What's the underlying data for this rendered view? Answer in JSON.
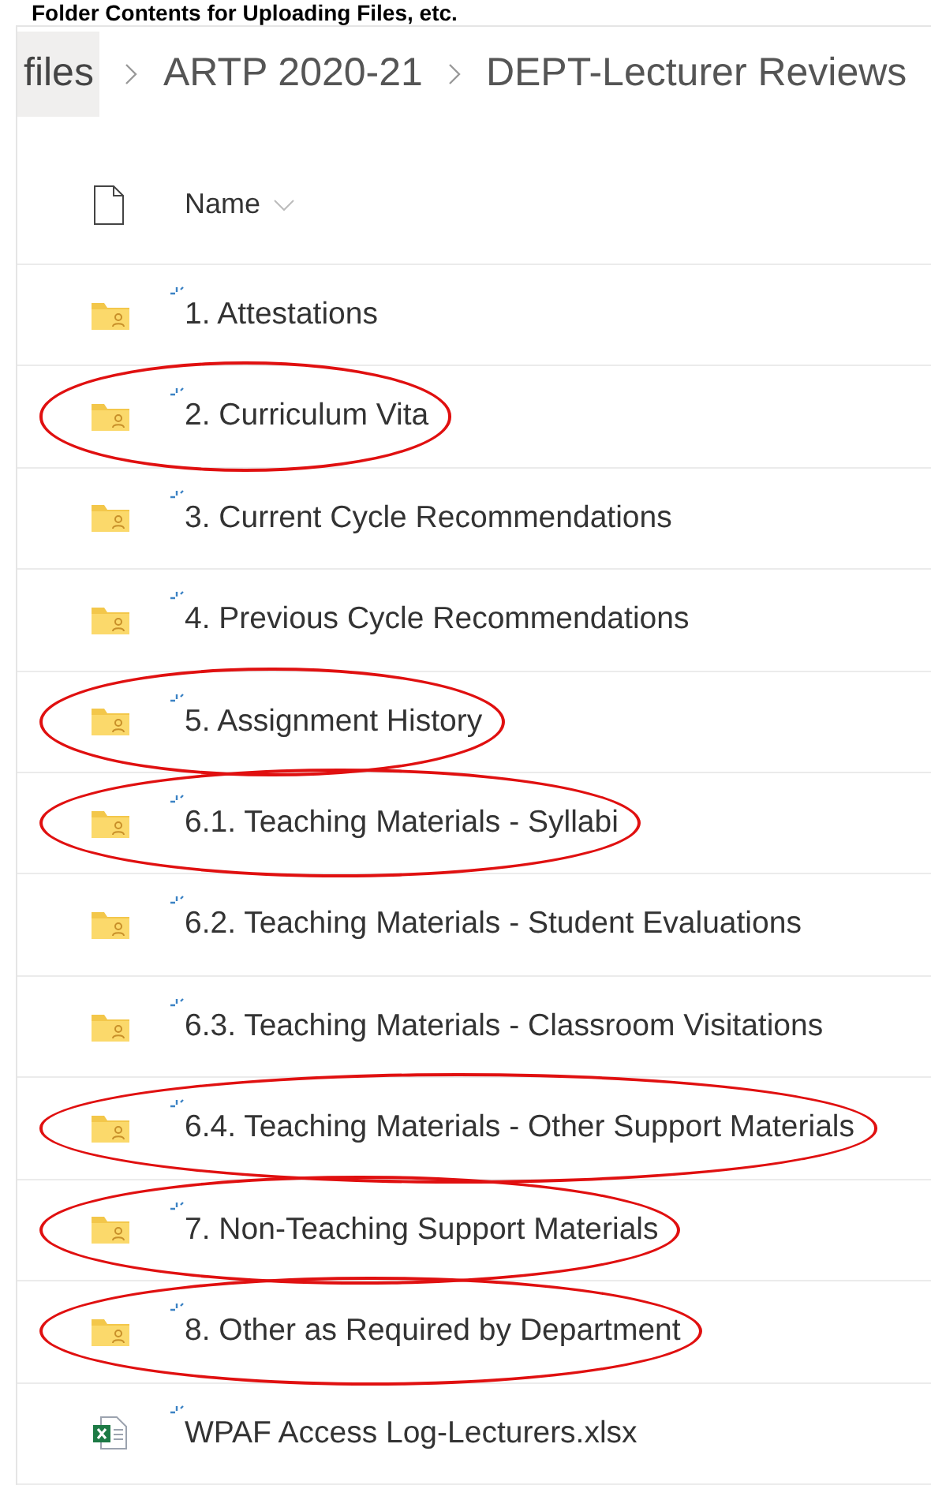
{
  "heading": "Folder Contents for Uploading Files, etc.",
  "breadcrumb": [
    {
      "label": "files",
      "selected": true
    },
    {
      "label": "ARTP 2020-21",
      "selected": false
    },
    {
      "label": "DEPT-Lecturer Reviews",
      "selected": false
    }
  ],
  "table": {
    "columns": [
      "Name"
    ],
    "rows": [
      {
        "kind": "folder",
        "name": "1. Attestations",
        "circled": false
      },
      {
        "kind": "folder",
        "name": "2. Curriculum Vita",
        "circled": true
      },
      {
        "kind": "folder",
        "name": "3. Current Cycle Recommendations",
        "circled": false
      },
      {
        "kind": "folder",
        "name": "4. Previous Cycle Recommendations",
        "circled": false
      },
      {
        "kind": "folder",
        "name": "5. Assignment History",
        "circled": true
      },
      {
        "kind": "folder",
        "name": "6.1. Teaching Materials - Syllabi",
        "circled": true
      },
      {
        "kind": "folder",
        "name": "6.2. Teaching Materials - Student Evaluations",
        "circled": false
      },
      {
        "kind": "folder",
        "name": "6.3. Teaching Materials - Classroom Visitations",
        "circled": false
      },
      {
        "kind": "folder",
        "name": "6.4. Teaching Materials - Other Support Materials",
        "circled": true
      },
      {
        "kind": "folder",
        "name": "7. Non-Teaching Support Materials",
        "circled": true
      },
      {
        "kind": "folder",
        "name": "8. Other as Required by Department",
        "circled": true
      },
      {
        "kind": "excel",
        "name": "WPAF Access Log-Lecturers.xlsx",
        "circled": false
      }
    ]
  }
}
